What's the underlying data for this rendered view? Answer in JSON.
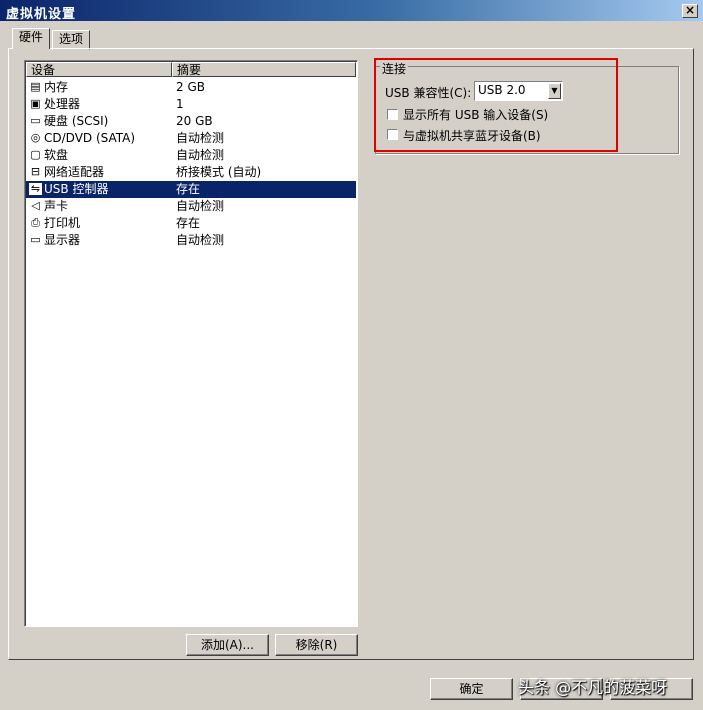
{
  "window": {
    "title": "虚拟机设置",
    "close_glyph": "×"
  },
  "tabs": [
    {
      "label": "硬件"
    },
    {
      "label": "选项"
    }
  ],
  "device_list": {
    "col_device": "设备",
    "col_summary": "摘要",
    "rows": [
      {
        "icon": "memory-icon",
        "name": "内存",
        "summary": "2 GB"
      },
      {
        "icon": "processor-icon",
        "name": "处理器",
        "summary": "1"
      },
      {
        "icon": "harddisk-icon",
        "name": "硬盘 (SCSI)",
        "summary": "20 GB"
      },
      {
        "icon": "cdrom-icon",
        "name": "CD/DVD (SATA)",
        "summary": "自动检测"
      },
      {
        "icon": "floppy-icon",
        "name": "软盘",
        "summary": "自动检测"
      },
      {
        "icon": "network-icon",
        "name": "网络适配器",
        "summary": "桥接模式 (自动)"
      },
      {
        "icon": "usb-icon",
        "name": "USB 控制器",
        "summary": "存在"
      },
      {
        "icon": "sound-icon",
        "name": "声卡",
        "summary": "自动检测"
      },
      {
        "icon": "printer-icon",
        "name": "打印机",
        "summary": "存在"
      },
      {
        "icon": "display-icon",
        "name": "显示器",
        "summary": "自动检测"
      }
    ]
  },
  "buttons": {
    "add": "添加(A)...",
    "remove": "移除(R)",
    "ok": "确定"
  },
  "connection": {
    "group_title": "连接",
    "usb_compat_label": "USB 兼容性(C):",
    "usb_compat_value": "USB 2.0",
    "show_all_usb_input": "显示所有 USB 输入设备(S)",
    "share_bluetooth": "与虚拟机共享蓝牙设备(B)"
  },
  "watermark": "头条 @不凡的菠菜呀"
}
